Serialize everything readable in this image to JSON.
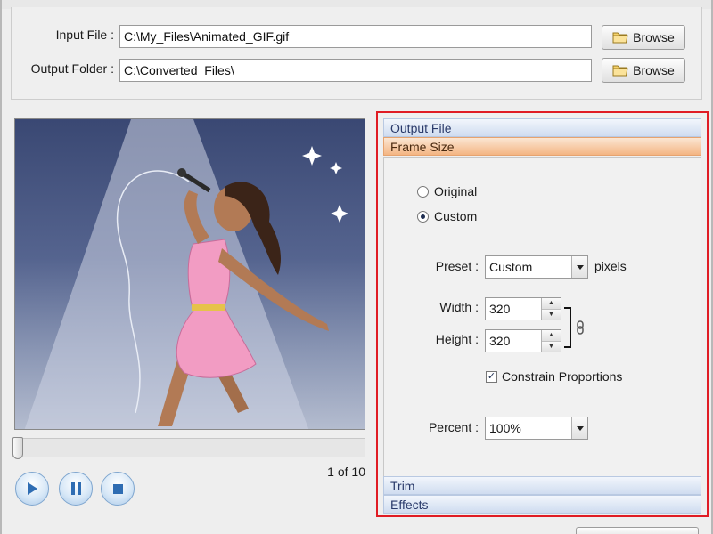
{
  "file_panel": {
    "input_label": "Input File :",
    "input_value": "C:\\My_Files\\Animated_GIF.gif",
    "output_label": "Output Folder :",
    "output_value": "C:\\Converted_Files\\",
    "browse_label": "Browse"
  },
  "player": {
    "frame_counter": "1 of 10",
    "progress": 0.0
  },
  "settings": {
    "sections": {
      "output_file": "Output File",
      "frame_size": "Frame Size",
      "trim": "Trim",
      "effects": "Effects"
    },
    "active_section": "Frame Size",
    "frame_size": {
      "radio_original": "Original",
      "radio_custom": "Custom",
      "selected_radio": "Custom",
      "preset_label": "Preset :",
      "preset_value": "Custom",
      "pixels_label": "pixels",
      "width_label": "Width :",
      "width_value": "320",
      "height_label": "Height :",
      "height_value": "320",
      "constrain_label": "Constrain Proportions",
      "constrain_checked": true,
      "percent_label": "Percent :",
      "percent_value": "100%"
    }
  },
  "icons": {
    "browse": "folder-icon",
    "play": "play-icon",
    "pause": "pause-icon",
    "stop": "stop-icon",
    "link": "chain-link-icon",
    "dropdown": "chevron-down-icon"
  },
  "colors": {
    "highlight_border": "#e01c24",
    "active_section": "#f4b583",
    "section_header": "#cfdcf0",
    "button_blue": "#a9c8e8"
  }
}
